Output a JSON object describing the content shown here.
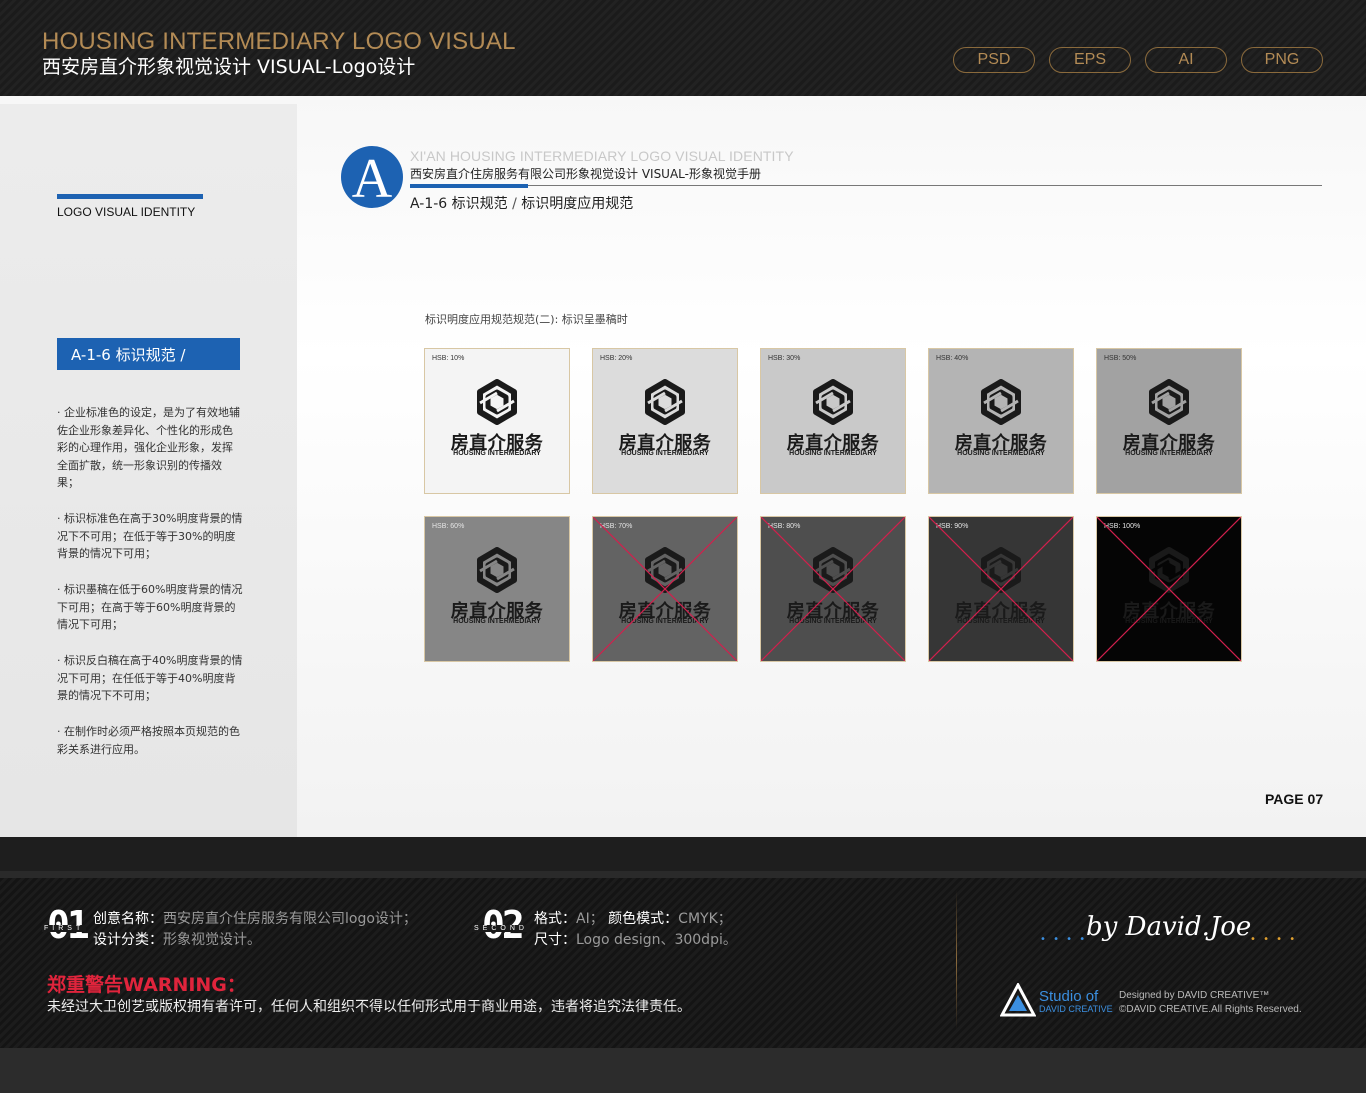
{
  "header": {
    "title_en": "HOUSING INTERMEDIARY LOGO VISUAL",
    "title_cn": "西安房直介形象视觉设计  VISUAL-Logo设计",
    "formats": [
      "PSD",
      "EPS",
      "AI",
      "PNG"
    ]
  },
  "sidebar": {
    "label": "LOGO VISUAL IDENTITY",
    "section": "A-1-6 标识规范 /",
    "paragraphs": [
      "· 企业标准色的设定，是为了有效地辅佐企业形象差异化、个性化的形成色彩的心理作用，强化企业形象，发挥全面扩散，统一形象识别的传播效果；",
      "· 标识标准色在高于30%明度背景的情况下不可用；在低于等于30%的明度背景的情况下可用；",
      "· 标识墨稿在低于60%明度背景的情况下可用；在高于等于60%明度背景的情况下可用；",
      "· 标识反白稿在高于40%明度背景的情况下可用；在任低于等于40%明度背景的情况下不可用；",
      "· 在制作时必须严格按照本页规范的色彩关系进行应用。"
    ]
  },
  "main": {
    "logo_letter": "A",
    "heading_en": "XI'AN HOUSING INTERMEDIARY LOGO VISUAL IDENTITY",
    "heading_cn": "西安房直介住房服务有限公司形象视觉设计  VISUAL-形象视觉手册",
    "subheading_code": "A-1-6 标识规范",
    "subheading_sep": " / ",
    "subheading_title": "标识明度应用规范",
    "caption": "标识明度应用规范规范(二): 标识呈墨稿时",
    "page": "PAGE 07"
  },
  "tiles": [
    {
      "label": "HSB: 10%",
      "brightness": 10,
      "bg": "#f4f4f4",
      "crossed": false
    },
    {
      "label": "HSB: 20%",
      "brightness": 20,
      "bg": "#dcdcdc",
      "crossed": false
    },
    {
      "label": "HSB: 30%",
      "brightness": 30,
      "bg": "#c9c9c9",
      "crossed": false
    },
    {
      "label": "HSB: 40%",
      "brightness": 40,
      "bg": "#b4b4b4",
      "crossed": false
    },
    {
      "label": "HSB: 50%",
      "brightness": 50,
      "bg": "#a2a2a2",
      "crossed": false
    },
    {
      "label": "HSB: 60%",
      "brightness": 60,
      "bg": "#868686",
      "crossed": false
    },
    {
      "label": "HSB: 70%",
      "brightness": 70,
      "bg": "#636363",
      "crossed": true
    },
    {
      "label": "HSB: 80%",
      "brightness": 80,
      "bg": "#4e4e4e",
      "crossed": true
    },
    {
      "label": "HSB: 90%",
      "brightness": 90,
      "bg": "#363636",
      "crossed": true
    },
    {
      "label": "HSB: 100%",
      "brightness": 100,
      "bg": "#050505",
      "crossed": true
    }
  ],
  "tile_logo": {
    "name": "房直介服务",
    "sub": "HOUSING INTERMEDIARY",
    "icon": "hexagon-knot-icon",
    "ink_color": "#1a1a1a",
    "cross_color": "#d1204d"
  },
  "footer": {
    "block1": {
      "num": "01",
      "tag": "FIRST",
      "line1_key": "创意名称：",
      "line1_val": "西安房直介住房服务有限公司logo设计；",
      "line2_key": "设计分类：",
      "line2_val": "形象视觉设计。"
    },
    "block2": {
      "num": "02",
      "tag": "SECOND",
      "line1_key": "格式：",
      "line1_val": "AI；",
      "line1_key2": "颜色模式：",
      "line1_val2": "CMYK；",
      "line2_key": "尺寸：",
      "line2_val": "Logo design、300dpi。"
    },
    "warning_title": "郑重警告WARNING：",
    "warning_text": "未经过大卫创艺或版权拥有者许可，任何人和组织不得以任何形式用于商业用途，违者将追究法律责任。",
    "signature": "by David.Joe",
    "studio_name": "Studio of",
    "studio_sub": "DAVID CREATIVE",
    "credit_line1": "Designed by DAVID CREATIVE™",
    "credit_line2": "©DAVID CREATIVE.All Rights Reserved."
  },
  "colors": {
    "gold": "#b38b55",
    "brand_blue": "#1d62b2",
    "warning_red": "#e0243c"
  }
}
